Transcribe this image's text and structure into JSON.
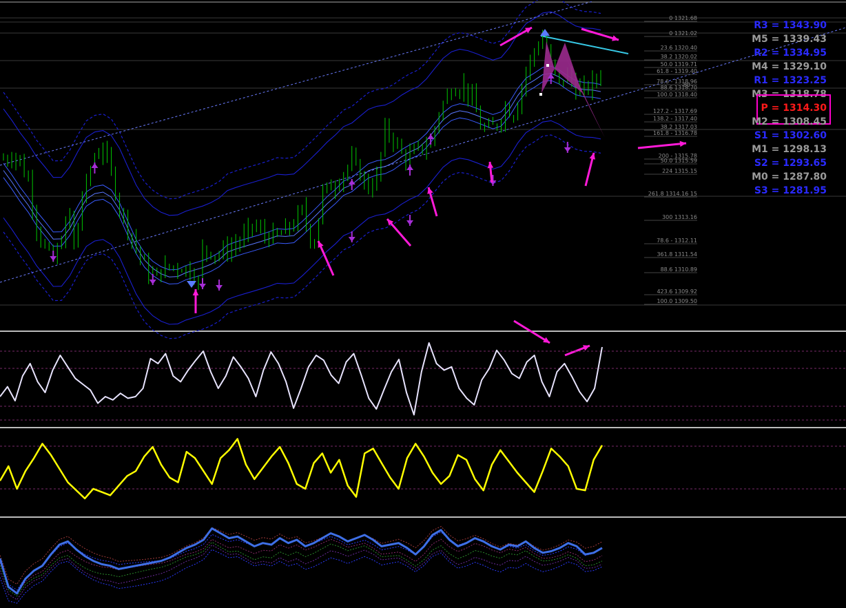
{
  "colors": {
    "background": "#000000",
    "candle": "#00c800",
    "channel": "#3a5cff",
    "envelope": "#1a1fd0",
    "arrow": "#ff1ad8",
    "fractal": "#a62dd6",
    "pattern": "#9b2a8e",
    "trendline_top": "#37c9e6",
    "osc1": "#e8e4ff",
    "osc2": "#ffff00",
    "osc3": "#3e6fe6",
    "pivot_box": "#ff00cc"
  },
  "pivots": [
    {
      "label": "R3 = 1343.90",
      "color": "#2a2aff"
    },
    {
      "label": "M5 = 1339.43",
      "color": "#9a9a9a"
    },
    {
      "label": "R2 = 1334.95",
      "color": "#2a2aff"
    },
    {
      "label": "M4 = 1329.10",
      "color": "#9a9a9a"
    },
    {
      "label": "R1 = 1323.25",
      "color": "#2a2aff"
    },
    {
      "label": "M3 = 1318.78",
      "color": "#9a9a9a"
    },
    {
      "label": "P   = 1314.30",
      "color": "#ff1a1a",
      "boxed": true
    },
    {
      "label": "M2 = 1308.45",
      "color": "#9a9a9a"
    },
    {
      "label": "S1 = 1302.60",
      "color": "#2a2aff"
    },
    {
      "label": "M1 = 1298.13",
      "color": "#9a9a9a"
    },
    {
      "label": "S2 = 1293.65",
      "color": "#2a2aff"
    },
    {
      "label": "M0 = 1287.80",
      "color": "#9a9a9a"
    },
    {
      "label": "S3 = 1281.95",
      "color": "#2a2aff"
    }
  ],
  "fib_labels": [
    "0 1321.68",
    "0 1321.02",
    "23.6 1320.40",
    "38.2 1320.02",
    "50.0 1319.71",
    "61.8 - 1319.40",
    "78.6 - 1318.96",
    "88.6 1318.70",
    "80",
    "100.0 1318.40",
    "127.2 - 1317.69",
    "138.2 - 1317.40",
    "38.2 1317.03",
    "161.8 - 1316.78",
    "200 - 1315.78",
    "50.0 1315.59",
    "224 1315.15",
    "261.8 1314.16 15",
    "300 1313.16",
    "78.6 - 1312.11",
    "361.8 1311.54",
    "88.6 1310.89",
    "423.6 1309.92",
    "100.0 1309.50"
  ],
  "chart_data": [
    {
      "type": "candlestick",
      "title": "",
      "ylim": [
        1309.5,
        1322.0
      ],
      "price_path": [
        [
          0,
          1315.8
        ],
        [
          3,
          1316.0
        ],
        [
          6,
          1314.9
        ],
        [
          8,
          1313.0
        ],
        [
          10,
          1312.0
        ],
        [
          12,
          1311.5
        ],
        [
          14,
          1312.4
        ],
        [
          16,
          1313.5
        ],
        [
          17,
          1312.0
        ],
        [
          19,
          1314.2
        ],
        [
          22,
          1315.9
        ],
        [
          24,
          1316.3
        ],
        [
          26,
          1315.2
        ],
        [
          28,
          1313.8
        ],
        [
          31,
          1312.5
        ],
        [
          34,
          1311.3
        ],
        [
          36,
          1310.8
        ],
        [
          38,
          1311.1
        ],
        [
          41,
          1311.3
        ],
        [
          44,
          1311.2
        ],
        [
          46,
          1311.0
        ],
        [
          47,
          1310.6
        ],
        [
          48,
          1312.0
        ],
        [
          52,
          1311.8
        ],
        [
          55,
          1312.1
        ],
        [
          58,
          1312.5
        ],
        [
          60,
          1313.0
        ],
        [
          63,
          1312.6
        ],
        [
          66,
          1312.5
        ],
        [
          70,
          1313.1
        ],
        [
          72,
          1313.6
        ],
        [
          74,
          1312.5
        ],
        [
          75,
          1312.4
        ],
        [
          77,
          1314.4
        ],
        [
          80,
          1314.8
        ],
        [
          84,
          1315.7
        ],
        [
          86,
          1315.2
        ],
        [
          88,
          1314.6
        ],
        [
          90,
          1315.0
        ],
        [
          92,
          1317.0
        ],
        [
          94,
          1316.7
        ],
        [
          96,
          1316.0
        ],
        [
          98,
          1315.9
        ],
        [
          100,
          1316.2
        ],
        [
          103,
          1316.5
        ],
        [
          105,
          1317.8
        ],
        [
          108,
          1318.8
        ],
        [
          111,
          1318.9
        ],
        [
          113,
          1318.3
        ],
        [
          115,
          1317.2
        ],
        [
          117,
          1317.0
        ],
        [
          119,
          1317.3
        ],
        [
          121,
          1318.0
        ],
        [
          123,
          1317.7
        ],
        [
          126,
          1319.5
        ],
        [
          128,
          1320.4
        ],
        [
          130,
          1320.9
        ],
        [
          132,
          1319.8
        ],
        [
          134,
          1319.0
        ],
        [
          136,
          1319.4
        ],
        [
          138,
          1318.8
        ],
        [
          140,
          1318.7
        ],
        [
          142,
          1319.0
        ],
        [
          144,
          1319.4
        ]
      ],
      "fractal_count": 13,
      "arrow_count": 14
    },
    {
      "type": "line",
      "series": [
        {
          "values": [
            0.3,
            0.42,
            0.25,
            0.55,
            0.7,
            0.48,
            0.35,
            0.62,
            0.8,
            0.66,
            0.52,
            0.45,
            0.38,
            0.22,
            0.3,
            0.26,
            0.34,
            0.28,
            0.3,
            0.4,
            0.76,
            0.7,
            0.82,
            0.55,
            0.48,
            0.62,
            0.74,
            0.85,
            0.6,
            0.4,
            0.55,
            0.78,
            0.66,
            0.52,
            0.3,
            0.62,
            0.84,
            0.7,
            0.48,
            0.16,
            0.4,
            0.66,
            0.8,
            0.74,
            0.56,
            0.46,
            0.72,
            0.82,
            0.56,
            0.28,
            0.15,
            0.38,
            0.6,
            0.75,
            0.35,
            0.08,
            0.6,
            0.95,
            0.7,
            0.62,
            0.66,
            0.4,
            0.28,
            0.2,
            0.5,
            0.64,
            0.86,
            0.74,
            0.58,
            0.52,
            0.72,
            0.8,
            0.48,
            0.3,
            0.6,
            0.7,
            0.54,
            0.36,
            0.24,
            0.4,
            0.9
          ]
        }
      ]
    },
    {
      "type": "line",
      "series": [
        {
          "values": [
            0.4,
            0.58,
            0.3,
            0.52,
            0.68,
            0.86,
            0.72,
            0.55,
            0.38,
            0.28,
            0.18,
            0.3,
            0.26,
            0.22,
            0.34,
            0.46,
            0.52,
            0.7,
            0.82,
            0.6,
            0.44,
            0.38,
            0.76,
            0.68,
            0.52,
            0.36,
            0.68,
            0.78,
            0.92,
            0.6,
            0.42,
            0.56,
            0.7,
            0.82,
            0.62,
            0.36,
            0.3,
            0.62,
            0.74,
            0.5,
            0.66,
            0.34,
            0.2,
            0.74,
            0.8,
            0.62,
            0.44,
            0.3,
            0.68,
            0.86,
            0.7,
            0.5,
            0.36,
            0.46,
            0.72,
            0.66,
            0.42,
            0.28,
            0.6,
            0.78,
            0.64,
            0.5,
            0.38,
            0.26,
            0.52,
            0.8,
            0.7,
            0.58,
            0.3,
            0.28,
            0.66,
            0.84
          ]
        }
      ]
    },
    {
      "type": "line",
      "series": [
        {
          "values": [
            0.55,
            0.2,
            0.12,
            0.3,
            0.4,
            0.46,
            0.6,
            0.72,
            0.76,
            0.66,
            0.58,
            0.52,
            0.48,
            0.46,
            0.42,
            0.44,
            0.46,
            0.48,
            0.5,
            0.52,
            0.56,
            0.62,
            0.68,
            0.72,
            0.78,
            0.92,
            0.86,
            0.8,
            0.82,
            0.76,
            0.7,
            0.74,
            0.72,
            0.8,
            0.74,
            0.78,
            0.7,
            0.74,
            0.8,
            0.86,
            0.82,
            0.76,
            0.8,
            0.84,
            0.78,
            0.7,
            0.72,
            0.74,
            0.68,
            0.6,
            0.7,
            0.84,
            0.9,
            0.78,
            0.7,
            0.74,
            0.8,
            0.76,
            0.7,
            0.66,
            0.72,
            0.7,
            0.76,
            0.68,
            0.62,
            0.64,
            0.68,
            0.74,
            0.7,
            0.6,
            0.62,
            0.68
          ]
        }
      ]
    }
  ]
}
